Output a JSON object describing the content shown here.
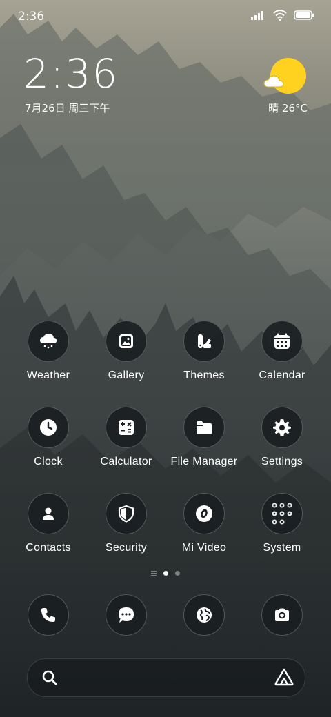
{
  "status": {
    "time": "2:36"
  },
  "widget": {
    "clock": "2:36",
    "date": "7月26日 周三下午",
    "weather": "晴 26°C"
  },
  "apps": [
    {
      "label": "Weather",
      "icon": "weather-cloud-icon"
    },
    {
      "label": "Gallery",
      "icon": "gallery-icon"
    },
    {
      "label": "Themes",
      "icon": "themes-icon"
    },
    {
      "label": "Calendar",
      "icon": "calendar-icon"
    },
    {
      "label": "Clock",
      "icon": "clock-icon"
    },
    {
      "label": "Calculator",
      "icon": "calculator-icon"
    },
    {
      "label": "File Manager",
      "icon": "folder-icon"
    },
    {
      "label": "Settings",
      "icon": "gear-icon"
    },
    {
      "label": "Contacts",
      "icon": "person-icon"
    },
    {
      "label": "Security",
      "icon": "shield-icon"
    },
    {
      "label": "Mi Video",
      "icon": "video-icon"
    },
    {
      "label": "System",
      "icon": "system-folder-icon"
    }
  ],
  "dock": [
    {
      "icon": "phone-icon"
    },
    {
      "icon": "messages-icon"
    },
    {
      "icon": "browser-icon"
    },
    {
      "icon": "camera-icon"
    }
  ],
  "colors": {
    "sun": "#ffd21f",
    "icon_bg": "#191e21"
  }
}
